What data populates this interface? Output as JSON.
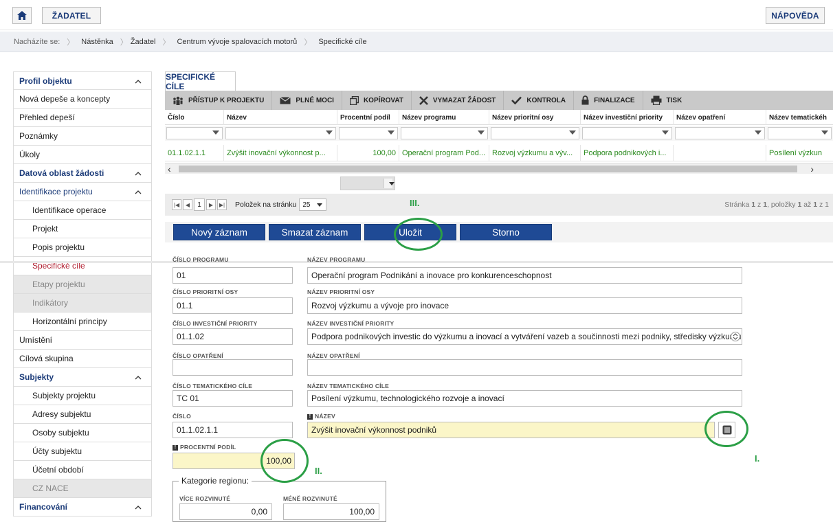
{
  "top": {
    "zadatel": "ŽADATEL",
    "help": "NÁPOVĚDA"
  },
  "breadcrumb": {
    "label": "Nacházíte se:",
    "items": [
      "Nástěnka",
      "Žadatel",
      "Centrum vývoje spalovacích motorů",
      "Specifické cíle"
    ]
  },
  "sidebar": {
    "profil": "Profil objektu",
    "items1": [
      "Nová depeše a koncepty",
      "Přehled depeší",
      "Poznámky",
      "Úkoly"
    ],
    "datova": "Datová oblast žádosti",
    "ident": "Identifikace projektu",
    "identSub": [
      "Identifikace operace",
      "Projekt",
      "Popis projektu"
    ],
    "active": "Specifické cíle",
    "disabled": [
      "Etapy projektu",
      "Indikátory"
    ],
    "horiz": "Horizontální principy",
    "items2": [
      "Umístění",
      "Cílová skupina"
    ],
    "subjekty": "Subjekty",
    "subjSub": [
      "Subjekty projektu",
      "Adresy subjektu",
      "Osoby subjektu",
      "Účty subjektu",
      "Účetní období"
    ],
    "czNace": "CZ NACE",
    "financovani": "Financování"
  },
  "tab": "SPECIFICKÉ CÍLE",
  "toolbar": [
    "PŘÍSTUP K PROJEKTU",
    "PLNÉ MOCI",
    "KOPÍROVAT",
    "VYMAZAT ŽÁDOST",
    "KONTROLA",
    "FINALIZACE",
    "TISK"
  ],
  "grid": {
    "headers": [
      "Číslo",
      "Název",
      "Procentní podíl",
      "Název programu",
      "Název prioritní osy",
      "Název investiční priority",
      "Název opatření",
      "Název tematickéh"
    ],
    "row": [
      "01.1.02.1.1",
      "Zvýšit inovační výkonnost p...",
      "100,00",
      "Operační program Pod...",
      "Rozvoj výzkumu a výv...",
      "Podpora podnikových i...",
      "",
      "Posílení výzkun"
    ]
  },
  "pager": {
    "page": "1",
    "perPageLabel": "Položek na stránku",
    "perPage": "25",
    "info1": "Stránka ",
    "info2": "1",
    "info3": " z ",
    "info4": "1",
    "info5": ", položky ",
    "info6": "1",
    "info7": " až ",
    "info8": "1",
    "info9": " z 1"
  },
  "buttons": {
    "new": "Nový záznam",
    "delete": "Smazat záznam",
    "save": "Uložit",
    "cancel": "Storno"
  },
  "form": {
    "cisloProgramuLbl": "ČÍSLO PROGRAMU",
    "cisloProgramu": "01",
    "nazevProgramuLbl": "NÁZEV PROGRAMU",
    "nazevProgramu": "Operační program Podnikání a inovace pro konkurenceschopnost",
    "cisloOsyLbl": "ČÍSLO PRIORITNÍ OSY",
    "cisloOsy": "01.1",
    "nazevOsyLbl": "NÁZEV PRIORITNÍ OSY",
    "nazevOsy": "Rozvoj výzkumu a vývoje pro inovace",
    "cisloPriorityLbl": "ČÍSLO INVESTIČNÍ PRIORITY",
    "cisloPriority": "01.1.02",
    "nazevPriorityLbl": "NÁZEV INVESTIČNÍ PRIORITY",
    "nazevPriority": "Podpora podnikových investic do výzkumu a inovací a vytváření vazeb a součinnosti mezi podniky, středisky výzkumu a",
    "cisloOpatreniLbl": "ČÍSLO OPATŘENÍ",
    "nazevOpatreniLbl": "NÁZEV OPATŘENÍ",
    "cisloTcLbl": "ČÍSLO TEMATICKÉHO CÍLE",
    "cisloTc": "TC 01",
    "nazevTcLbl": "NÁZEV TEMATICKÉHO CÍLE",
    "nazevTc": "Posílení výzkumu, technologického rozvoje a inovací",
    "cisloLbl": "ČÍSLO",
    "cislo": "01.1.02.1.1",
    "nazevLbl": "NÁZEV",
    "nazev": "Zvýšit inovační výkonnost podniků",
    "podilLbl": "PROCENTNÍ PODÍL",
    "podil": "100,00",
    "kategorie": "Kategorie regionu:",
    "viceLbl": "VÍCE ROZVINUTÉ",
    "vice": "0,00",
    "meneLbl": "MÉNĚ ROZVINUTÉ",
    "mene": "100,00"
  },
  "annotations": {
    "i": "I.",
    "ii": "II.",
    "iii": "III."
  },
  "colors": {
    "navy": "#1a3a78",
    "button": "#1f4a95",
    "green": "#2b9f46",
    "dataGreen": "#2a8a1e",
    "active": "#b01c2e"
  }
}
